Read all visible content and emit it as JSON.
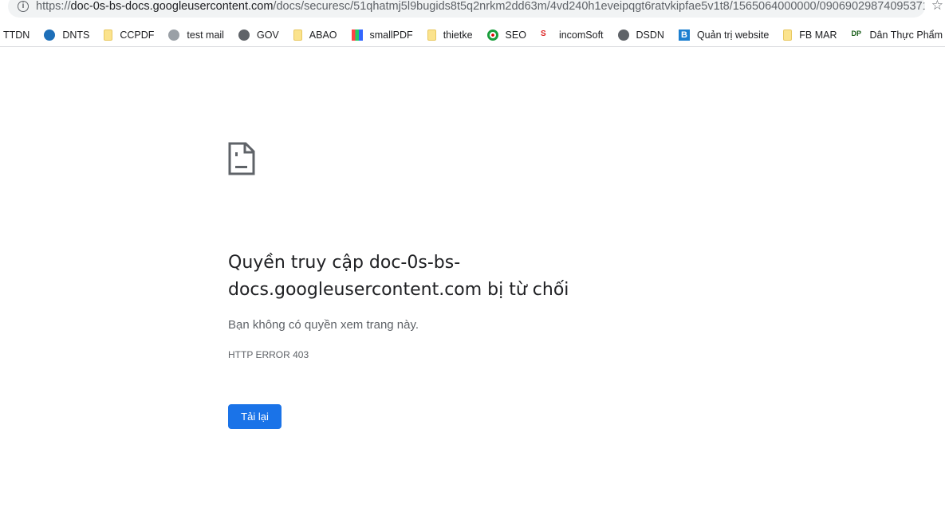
{
  "browser": {
    "url_scheme": "https://",
    "url_host": "doc-0s-bs-docs.googleusercontent.com",
    "url_path": "/docs/securesc/51qhatmj5l9bugids8t5q2nrkm2dd63m/4vd240h1eveipqgt6ratvkipfae5v1t8/1565064000000/090690298740953719...",
    "bookmarks": [
      {
        "label": "TTDN",
        "icon": "none"
      },
      {
        "label": "DNTS",
        "icon": "globe-logo-icon"
      },
      {
        "label": "CCPDF",
        "icon": "folder-icon"
      },
      {
        "label": "test mail",
        "icon": "elephant-icon"
      },
      {
        "label": "GOV",
        "icon": "globe-icon"
      },
      {
        "label": "ABAO",
        "icon": "folder-icon"
      },
      {
        "label": "smallPDF",
        "icon": "smallpdf-icon"
      },
      {
        "label": "thietke",
        "icon": "folder-icon"
      },
      {
        "label": "SEO",
        "icon": "target-icon"
      },
      {
        "label": "incomSoft",
        "icon": "incomsoft-icon"
      },
      {
        "label": "DSDN",
        "icon": "globe-icon"
      },
      {
        "label": "Quản trị website",
        "icon": "b-icon"
      },
      {
        "label": "FB MAR",
        "icon": "folder-icon"
      },
      {
        "label": "Dân Thực Phẩm",
        "icon": "dtp-icon"
      }
    ]
  },
  "error": {
    "title": "Quyền truy cập doc-0s-bs-docs.googleusercontent.com bị từ chối",
    "description": "Bạn không có quyền xem trang này.",
    "code": "HTTP ERROR 403",
    "reload_label": "Tải lại",
    "accent": "#1a73e8"
  }
}
